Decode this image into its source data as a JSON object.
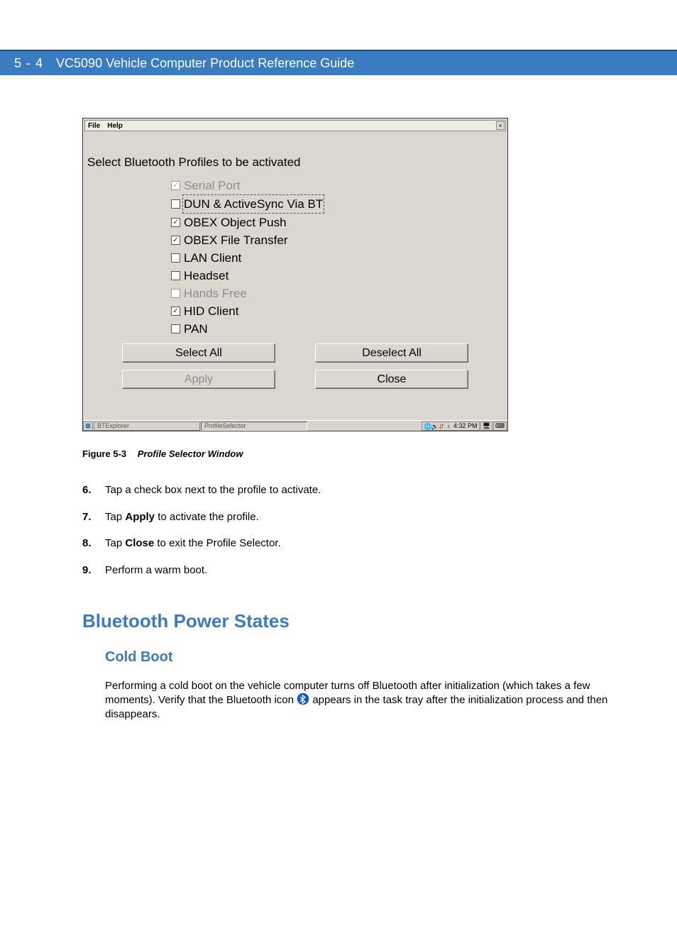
{
  "header": {
    "page_num": "5 - 4",
    "title": "VC5090 Vehicle Computer Product Reference Guide"
  },
  "window": {
    "menu": {
      "file": "File",
      "help": "Help",
      "close_glyph": "×"
    },
    "prompt": "Select Bluetooth Profiles to be activated",
    "profiles": [
      {
        "label": "Serial Port",
        "checked": true,
        "disabled": true,
        "focused": false
      },
      {
        "label": "DUN & ActiveSync Via BT",
        "checked": false,
        "disabled": false,
        "focused": true
      },
      {
        "label": "OBEX Object Push",
        "checked": true,
        "disabled": false,
        "focused": false
      },
      {
        "label": "OBEX File Transfer",
        "checked": true,
        "disabled": false,
        "focused": false
      },
      {
        "label": "LAN Client",
        "checked": false,
        "disabled": false,
        "focused": false
      },
      {
        "label": "Headset",
        "checked": false,
        "disabled": false,
        "focused": false
      },
      {
        "label": "Hands Free",
        "checked": false,
        "disabled": true,
        "focused": false
      },
      {
        "label": "HID Client",
        "checked": true,
        "disabled": false,
        "focused": false
      },
      {
        "label": "PAN",
        "checked": false,
        "disabled": false,
        "focused": false
      }
    ],
    "buttons": {
      "select_all": "Select All",
      "deselect_all": "Deselect All",
      "apply": "Apply",
      "close": "Close",
      "apply_disabled": true
    },
    "taskbar": {
      "items": [
        {
          "label": "BTExplorer",
          "pressed": false
        },
        {
          "label": "ProfileSelector",
          "pressed": true
        }
      ],
      "clock": "4:32 PM"
    }
  },
  "figure": {
    "label": "Figure 5-3",
    "caption": "Profile Selector Window"
  },
  "steps": {
    "s6_num": "6.",
    "s6": "Tap a check box next to the profile to activate.",
    "s7_num": "7.",
    "s7_a": "Tap ",
    "s7_b": "Apply",
    "s7_c": " to activate the profile.",
    "s8_num": "8.",
    "s8_a": "Tap ",
    "s8_b": "Close",
    "s8_c": " to exit the Profile Selector.",
    "s9_num": "9.",
    "s9": "Perform a warm boot."
  },
  "sections": {
    "h1": "Bluetooth Power States",
    "h2": "Cold Boot",
    "p_a": "Performing a cold boot on the vehicle computer turns off Bluetooth after initialization (which takes a few moments). Verify that the Bluetooth icon ",
    "p_b": " appears in the task tray after the initialization process and then disappears."
  }
}
